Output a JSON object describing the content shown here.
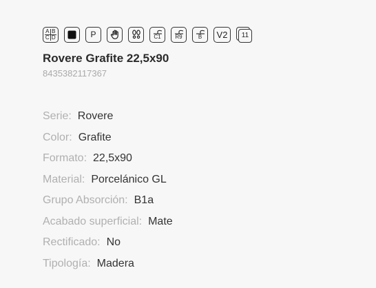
{
  "icons": {
    "abcd_letters": [
      "A",
      "B",
      "C",
      "D"
    ],
    "p_label": "P",
    "c1_label": "C1",
    "r9_label": "R9",
    "b_label": "B",
    "v2_label": "V2",
    "pack_label": "11"
  },
  "product": {
    "title": "Rovere Grafite 22,5x90",
    "ean": "8435382117367"
  },
  "specs": [
    {
      "label": "Serie:",
      "value": "Rovere"
    },
    {
      "label": "Color:",
      "value": "Grafite"
    },
    {
      "label": "Formato:",
      "value": "22,5x90"
    },
    {
      "label": "Material:",
      "value": "Porcelánico GL"
    },
    {
      "label": "Grupo Absorción:",
      "value": "B1a"
    },
    {
      "label": "Acabado superficial:",
      "value": "Mate"
    },
    {
      "label": "Rectificado:",
      "value": "No"
    },
    {
      "label": "Tipología:",
      "value": "Madera"
    }
  ]
}
